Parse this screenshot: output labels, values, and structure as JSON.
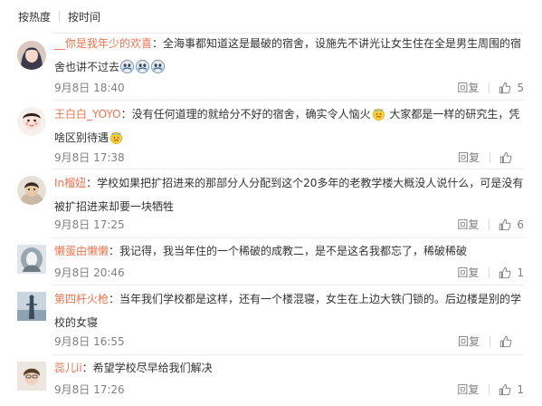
{
  "sort": {
    "hot_label": "按热度",
    "time_label": "按时间"
  },
  "comments": [
    {
      "username": "__你是我年少的欢喜",
      "text_line1": "：全海事都知道这是最破的宿舍，设施先不讲光让女生住在全是男生周围的宿",
      "text_line2": "舍也讲不过去",
      "time": "9月8日 18:40",
      "reply_label": "回复",
      "likes": "5"
    },
    {
      "username": "王白白_YOYO",
      "text_line1": "：没有任何道理的就给分不好的宿舍，确实令人恼火",
      "text_line1b": " 大家都是一样的研究生，凭",
      "text_line2": "啥区别待遇",
      "time": "9月8日 17:38",
      "reply_label": "回复",
      "likes": ""
    },
    {
      "username": "In榴妞",
      "text_line1": "：学校如果把扩招进来的那部分人分配到这个20多年的老教学楼大概没人说什么，可是没有",
      "text_line2": "被扩招进来却要一块牺牲",
      "time": "9月8日 17:25",
      "reply_label": "回复",
      "likes": "6"
    },
    {
      "username": "懒蛋由懒懒",
      "text_line1": "：我记得，我当年住的一个稀破的成教二，是不是这名我都忘了，稀破稀破",
      "time": "9月8日 20:46",
      "reply_label": "回复",
      "likes": "1"
    },
    {
      "username": "第四杆火枪",
      "text_line1": "：当年我们学校都是这样，还有一个楼混寝，女生在上边大铁门锁的。后边楼是别的学",
      "text_line2": "校的女寝",
      "time": "9月8日 16:55",
      "reply_label": "回复",
      "likes": ""
    },
    {
      "username": "蕊儿ii",
      "text_line1": "：希望学校尽早给我们解决",
      "time": "9月8日 17:26",
      "reply_label": "回复",
      "likes": "1"
    }
  ],
  "icons": {
    "emoji_sad": "doge-crying-emoji-icon",
    "emoji_angry": "angry-face-emoji-icon",
    "like": "thumbs-up-icon"
  },
  "colors": {
    "username": "#eb7350",
    "text": "#333333",
    "meta": "#808080",
    "divider": "#ececec"
  }
}
